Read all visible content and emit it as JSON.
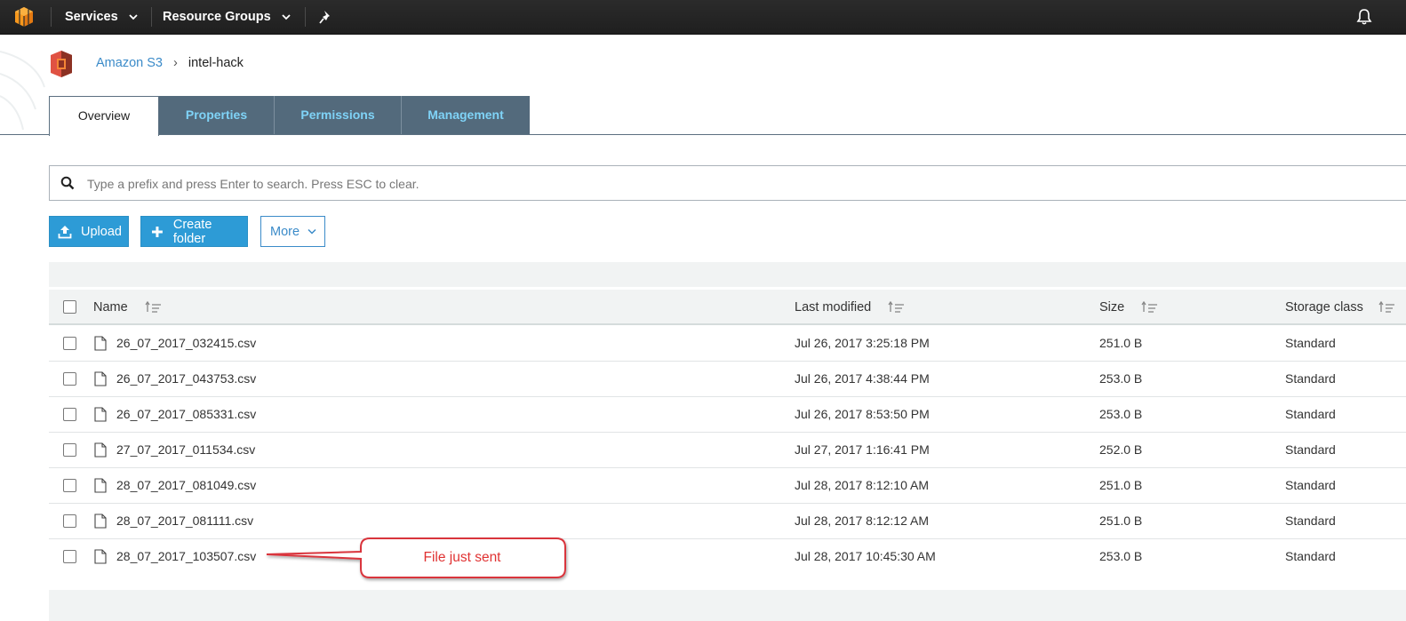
{
  "topnav": {
    "services_label": "Services",
    "resource_groups_label": "Resource Groups"
  },
  "breadcrumb": {
    "root": "Amazon S3",
    "separator": "›",
    "current": "intel-hack"
  },
  "tabs": [
    {
      "label": "Overview",
      "active": true
    },
    {
      "label": "Properties",
      "active": false
    },
    {
      "label": "Permissions",
      "active": false
    },
    {
      "label": "Management",
      "active": false
    }
  ],
  "search": {
    "placeholder": "Type a prefix and press Enter to search. Press ESC to clear.",
    "value": ""
  },
  "toolbar": {
    "upload_label": "Upload",
    "create_folder_label": "Create folder",
    "more_label": "More"
  },
  "table": {
    "columns": [
      "Name",
      "Last modified",
      "Size",
      "Storage class"
    ],
    "rows": [
      {
        "name": "26_07_2017_032415.csv",
        "modified": "Jul 26, 2017 3:25:18 PM",
        "size": "251.0 B",
        "storage": "Standard"
      },
      {
        "name": "26_07_2017_043753.csv",
        "modified": "Jul 26, 2017 4:38:44 PM",
        "size": "253.0 B",
        "storage": "Standard"
      },
      {
        "name": "26_07_2017_085331.csv",
        "modified": "Jul 26, 2017 8:53:50 PM",
        "size": "253.0 B",
        "storage": "Standard"
      },
      {
        "name": "27_07_2017_011534.csv",
        "modified": "Jul 27, 2017 1:16:41 PM",
        "size": "252.0 B",
        "storage": "Standard"
      },
      {
        "name": "28_07_2017_081049.csv",
        "modified": "Jul 28, 2017 8:12:10 AM",
        "size": "251.0 B",
        "storage": "Standard"
      },
      {
        "name": "28_07_2017_081111.csv",
        "modified": "Jul 28, 2017 8:12:12 AM",
        "size": "251.0 B",
        "storage": "Standard"
      },
      {
        "name": "28_07_2017_103507.csv",
        "modified": "Jul 28, 2017 10:45:30 AM",
        "size": "253.0 B",
        "storage": "Standard"
      }
    ]
  },
  "annotation": {
    "text": "File just sent",
    "color": "#e03232"
  },
  "colors": {
    "accent": "#2d9bd6",
    "tab_inactive_bg": "#536a7c",
    "tab_inactive_text": "#7fd3f7",
    "nav_bg": "#232323"
  },
  "icons": [
    "aws-cube-icon",
    "chevron-down-icon",
    "pin-icon",
    "bell-icon",
    "s3-bucket-icon",
    "search-icon",
    "upload-icon",
    "plus-icon",
    "sort-icon",
    "file-icon"
  ]
}
